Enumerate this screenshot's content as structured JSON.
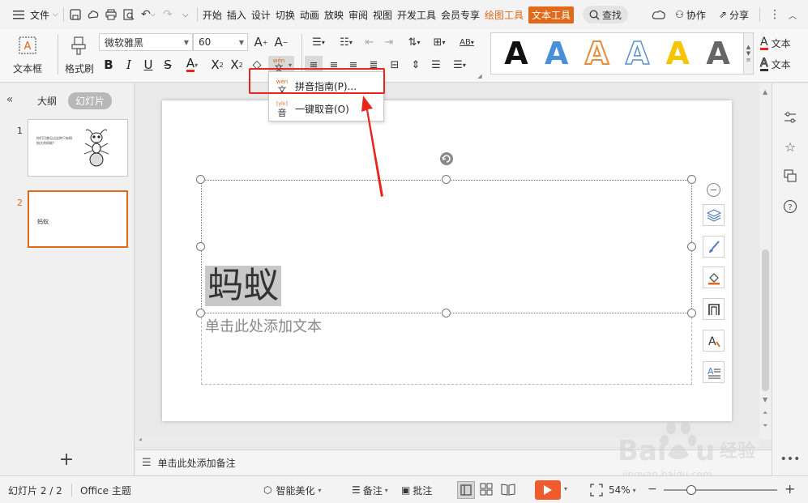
{
  "menubar": {
    "file_label": "文件",
    "tabs": [
      "开始",
      "插入",
      "设计",
      "切换",
      "动画",
      "放映",
      "审阅",
      "视图",
      "开发工具",
      "会员专享"
    ],
    "drawing_tools": "绘图工具",
    "text_tools": "文本工具",
    "search_label": "查找",
    "collab_label": "协作",
    "share_label": "分享"
  },
  "ribbon": {
    "textbox_label": "文本框",
    "format_painter_label": "格式刷",
    "font_name": "微软雅黑",
    "font_size": "60",
    "pinyin_icon_label": "wén",
    "text_fill_label": "文本",
    "text_outline_label": "文本",
    "gallery_letter": "A"
  },
  "dropdown": {
    "items": [
      {
        "label": "拼音指南(P)...",
        "icon_top": "wén",
        "icon_bottom": "文"
      },
      {
        "label": "一键取音(O)",
        "icon_top": "[yīn]",
        "icon_bottom": "音"
      }
    ]
  },
  "leftpanel": {
    "tab_outline": "大纲",
    "tab_slides": "幻灯片",
    "slides": [
      {
        "number": "1",
        "text": "你们可曾见过这种只有拇指大的蚂蚁？"
      },
      {
        "number": "2",
        "text": "蚂蚁"
      }
    ]
  },
  "slide": {
    "title": "蚂蚁",
    "subtitle": "单击此处添加文本"
  },
  "notes": {
    "placeholder": "单击此处添加备注"
  },
  "statusbar": {
    "slide_counter": "幻灯片 2 / 2",
    "theme": "Office 主题",
    "beautify": "智能美化",
    "notes": "备注",
    "comments": "批注",
    "zoom": "54%"
  },
  "colors": {
    "accent": "#e0691a",
    "annotation_red": "#e8251b",
    "title_highlight": "#c8c8c8"
  }
}
